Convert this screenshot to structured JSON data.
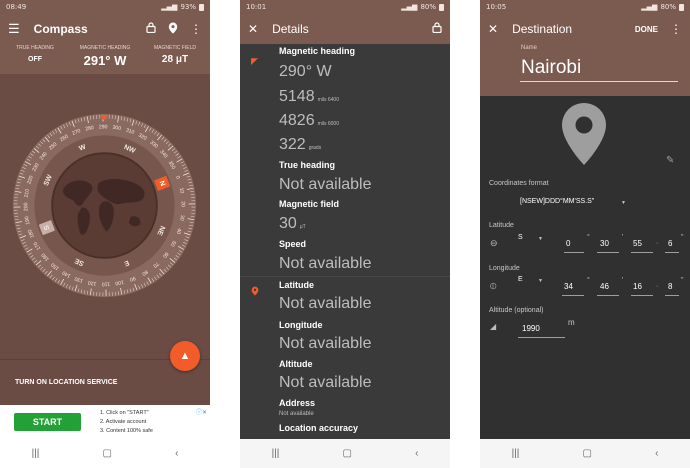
{
  "compass_screen": {
    "status": {
      "time": "08:49",
      "battery": "93%"
    },
    "toolbar": {
      "title": "Compass"
    },
    "info": {
      "true_heading_label": "TRUE HEADING",
      "true_heading_value": "OFF",
      "magnetic_heading_label": "MAGNETIC HEADING",
      "magnetic_heading_value": "291° W",
      "magnetic_field_label": "MAGNETIC FIELD",
      "magnetic_field_value": "28 μT"
    },
    "dial": {
      "cardinals": [
        "N",
        "NE",
        "E",
        "SE",
        "S",
        "SW",
        "W",
        "NW"
      ],
      "degree_labels": [
        "0",
        "10",
        "20",
        "30",
        "40",
        "50",
        "60",
        "70",
        "80",
        "90",
        "100",
        "110",
        "120",
        "130",
        "140",
        "150",
        "160",
        "170",
        "180",
        "190",
        "200",
        "210",
        "220",
        "230",
        "240",
        "250",
        "260",
        "270",
        "280",
        "290",
        "300",
        "310",
        "320",
        "330",
        "340",
        "350"
      ],
      "heading_deg": 291
    },
    "location_service": "TURN ON LOCATION SERVICE",
    "ad": {
      "button": "START",
      "lines": [
        "1. Click on \"START\"",
        "2. Activate account",
        "3. Content 100% safe"
      ]
    }
  },
  "details_screen": {
    "status": {
      "time": "10:01",
      "battery": "80%"
    },
    "toolbar": {
      "title": "Details"
    },
    "magnetic_heading": {
      "label": "Magnetic heading",
      "degrees": "290° W",
      "mils_6400": "5148",
      "mils_6400_unit": "mils 6400",
      "mils_6000": "4826",
      "mils_6000_unit": "mils 6000",
      "grads": "322",
      "grads_unit": "grads"
    },
    "true_heading": {
      "label": "True heading",
      "value": "Not available"
    },
    "magnetic_field": {
      "label": "Magnetic field",
      "value": "30",
      "unit": "μT"
    },
    "speed": {
      "label": "Speed",
      "value": "Not available"
    },
    "latitude": {
      "label": "Latitude",
      "value": "Not available"
    },
    "longitude": {
      "label": "Longitude",
      "value": "Not available"
    },
    "altitude": {
      "label": "Altitude",
      "value": "Not available"
    },
    "address": {
      "label": "Address",
      "value": "Not available"
    },
    "location_accuracy": {
      "label": "Location accuracy"
    }
  },
  "destination_screen": {
    "status": {
      "time": "10:05",
      "battery": "80%"
    },
    "toolbar": {
      "title": "Destination",
      "done": "DONE"
    },
    "name": {
      "label": "Name",
      "value": "Nairobi"
    },
    "coordinates_format": {
      "label": "Coordinates format",
      "value": "[NSEW]DDD°MM'SS.S\""
    },
    "latitude": {
      "label": "Latitude",
      "hemisphere": "S",
      "deg": "0",
      "min": "30",
      "sec": "55",
      "tenth": "6"
    },
    "longitude": {
      "label": "Longitude",
      "hemisphere": "E",
      "deg": "34",
      "min": "46",
      "sec": "16",
      "tenth": "8"
    },
    "altitude": {
      "label": "Altitude (optional)",
      "value": "1990",
      "unit": "m"
    }
  },
  "colors": {
    "brown_primary": "#7b5a50",
    "brown_dark": "#6b4c44",
    "accent_orange": "#f25b2a",
    "dark_bg": "#3a3a3a",
    "ad_green": "#23a136"
  }
}
